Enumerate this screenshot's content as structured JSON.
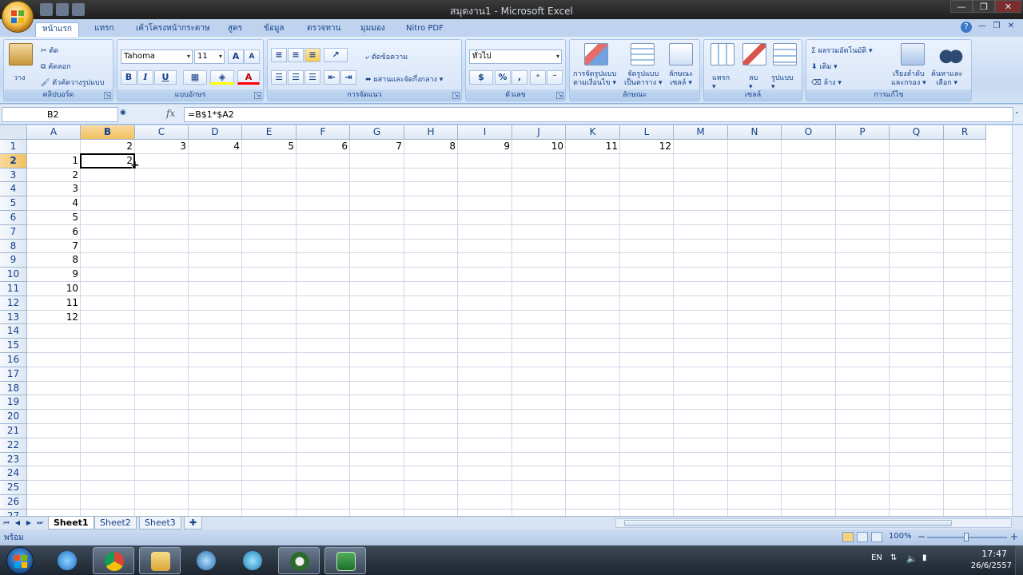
{
  "window": {
    "title": "สมุดงาน1 - Microsoft Excel",
    "controls": {
      "minimize": "—",
      "maximize": "❐",
      "close": "✕"
    }
  },
  "ribbon": {
    "tabs": [
      {
        "label": "หน้าแรก",
        "active": true
      },
      {
        "label": "แทรก"
      },
      {
        "label": "เค้าโครงหน้ากระดาษ"
      },
      {
        "label": "สูตร"
      },
      {
        "label": "ข้อมูล"
      },
      {
        "label": "ตรวจทาน"
      },
      {
        "label": "มุมมอง"
      },
      {
        "label": "Nitro PDF"
      }
    ],
    "clipboard": {
      "label": "คลิปบอร์ด",
      "paste": "วาง",
      "cut": "ตัด",
      "copy": "คัดลอก",
      "format_painter": "ตัวคัดวางรูปแบบ"
    },
    "font": {
      "label": "แบบอักษร",
      "font_name": "Tahoma",
      "font_size": "11",
      "grow": "A",
      "shrink": "A",
      "bold": "B",
      "italic": "I",
      "underline": "U",
      "font_color": "A"
    },
    "alignment": {
      "label": "การจัดแนว",
      "wrap_text": "ตัดข้อความ",
      "merge_center": "ผสานและจัดกึ่งกลาง"
    },
    "number": {
      "label": "ตัวเลข",
      "format": "ทั่วไป",
      "percent": "%",
      "comma": ","
    },
    "styles": {
      "label": "ลักษณะ",
      "conditional_formatting": [
        "การจัดรูปแบบ",
        "ตามเงื่อนไข"
      ],
      "format_as_table": [
        "จัดรูปแบบ",
        "เป็นตาราง"
      ],
      "cell_styles": [
        "ลักษณะ",
        "เซลล์"
      ]
    },
    "cells": {
      "label": "เซลล์",
      "insert": "แทรก",
      "delete": "ลบ",
      "format": "รูปแบบ"
    },
    "editing": {
      "label": "การแก้ไข",
      "autosum": "ผลรวมอัตโนมัติ",
      "fill": "เติม",
      "clear": "ล้าง",
      "sort_filter": [
        "เรียงลำดับ",
        "และกรอง"
      ],
      "find_select": [
        "ค้นหาและ",
        "เลือก"
      ]
    }
  },
  "formula_bar": {
    "name_box": "B2",
    "fx": "fx",
    "formula": "=B$1*$A2"
  },
  "sheet": {
    "columns": [
      "A",
      "B",
      "C",
      "D",
      "E",
      "F",
      "G",
      "H",
      "I",
      "J",
      "K",
      "L",
      "M",
      "N",
      "O",
      "P",
      "Q",
      "R"
    ],
    "selected_column": "B",
    "selected_row": 2,
    "row_numbers": [
      "1",
      "2",
      "3",
      "4",
      "5",
      "6",
      "7",
      "8",
      "9",
      "10",
      "11",
      "12",
      "13",
      "14",
      "15",
      "16",
      "17",
      "18",
      "19",
      "20",
      "21",
      "22",
      "23",
      "24",
      "25",
      "26",
      "27"
    ],
    "row1_values": [
      "2",
      "3",
      "4",
      "5",
      "6",
      "7",
      "8",
      "9",
      "10",
      "11",
      "12"
    ],
    "colA_values": [
      "1",
      "2",
      "3",
      "4",
      "5",
      "6",
      "7",
      "8",
      "9",
      "10",
      "11",
      "12"
    ],
    "active_cell_value": "2"
  },
  "sheet_tabs": {
    "nav": [
      "⏮",
      "◀",
      "▶",
      "⏭"
    ],
    "tabs": [
      {
        "label": "Sheet1",
        "active": true
      },
      {
        "label": "Sheet2"
      },
      {
        "label": "Sheet3"
      }
    ]
  },
  "status_bar": {
    "status": "พร้อม",
    "zoom": "100%",
    "zoom_minus": "−",
    "zoom_plus": "+"
  },
  "taskbar": {
    "apps": [
      "start-menu",
      "internet-explorer",
      "chrome",
      "file-explorer",
      "media-player",
      "network",
      "app",
      "excel"
    ],
    "lang": "EN",
    "time": "17:47",
    "date": "26/6/2557"
  }
}
